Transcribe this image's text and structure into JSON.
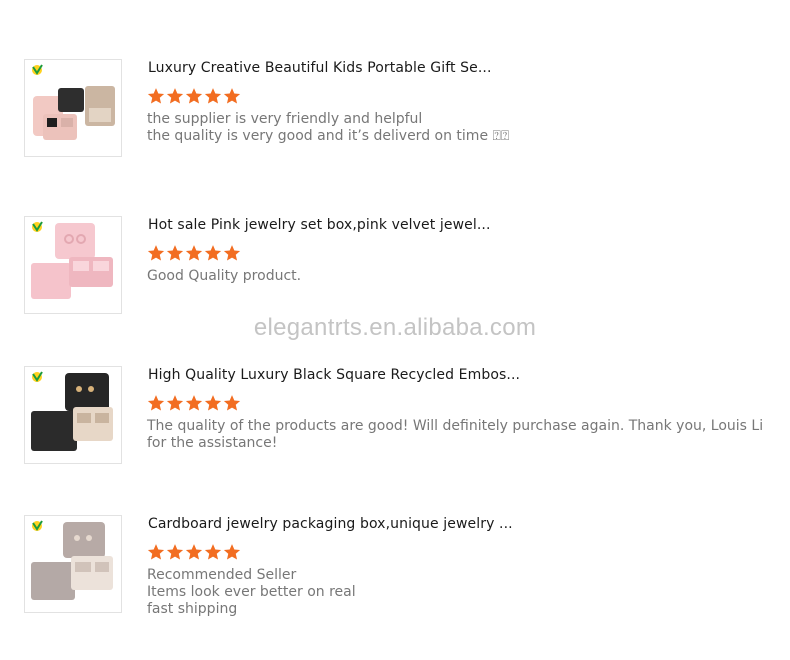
{
  "watermark": "elegantrts.en.alibaba.com",
  "reviews": [
    {
      "title": "Luxury Creative Beautiful Kids Portable Gift Se...",
      "rating": 5,
      "comment": [
        "the supplier is very friendly and helpful",
        "the quality is very good and it’s deliverd on time ⍰⍰"
      ],
      "thumb_color": "#f2c9c3"
    },
    {
      "title": "Hot sale Pink jewelry set box,pink velvet jewel...",
      "rating": 5,
      "comment": [
        "Good Quality product."
      ],
      "thumb_color": "#f6c8cf"
    },
    {
      "title": "High Quality Luxury Black Square Recycled Embos...",
      "rating": 5,
      "comment": [
        "The quality of the products are good! Will definitely purchase again. Thank you, Louis Li",
        "for the assistance!"
      ],
      "thumb_color": "#2b2b2b"
    },
    {
      "title": "Cardboard jewelry packaging box,unique jewelry ...",
      "rating": 5,
      "comment": [
        "Recommended Seller",
        "Items look ever better on real",
        "fast shipping"
      ],
      "thumb_color": "#b9aeab"
    }
  ],
  "colors": {
    "star": "#f26d21",
    "title": "#1a1a1a",
    "comment": "#777777",
    "watermark": "#c4c4c4"
  },
  "icons": {
    "badge": "verified-supplier-badge-icon",
    "star": "star-icon"
  }
}
